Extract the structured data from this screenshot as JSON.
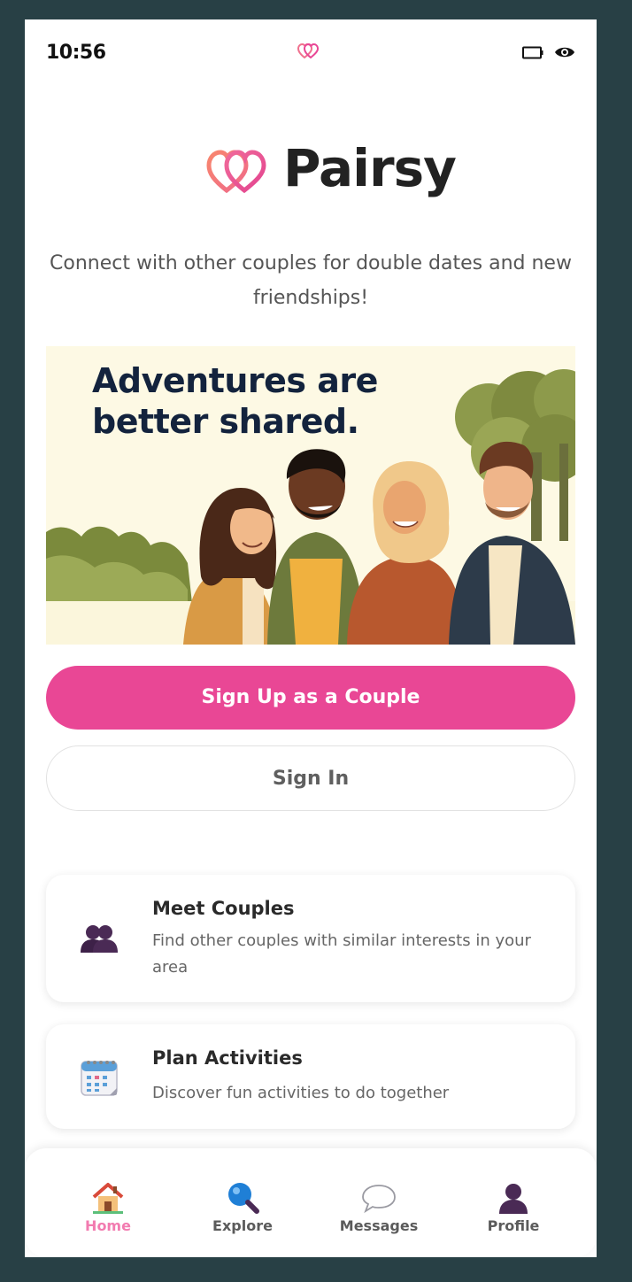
{
  "status_bar": {
    "time": "10:56"
  },
  "brand": {
    "name": "Pairsy",
    "accent_color": "#e94795"
  },
  "tagline": "Connect with other couples for double dates and new friendships!",
  "hero": {
    "headline_line1": "Adventures are",
    "headline_line2": "better shared."
  },
  "actions": {
    "signup_label": "Sign Up as a Couple",
    "signin_label": "Sign In"
  },
  "features": [
    {
      "icon": "couple-icon",
      "title": "Meet Couples",
      "description": "Find other couples with similar interests in your area"
    },
    {
      "icon": "calendar-icon",
      "title": "Plan Activities",
      "description": "Discover fun activities to do together"
    }
  ],
  "bottom_nav": {
    "items": [
      {
        "label": "Home",
        "icon": "home-icon",
        "active": true
      },
      {
        "label": "Explore",
        "icon": "magnifier-icon",
        "active": false
      },
      {
        "label": "Messages",
        "icon": "speech-bubble-icon",
        "active": false
      },
      {
        "label": "Profile",
        "icon": "person-icon",
        "active": false
      }
    ]
  }
}
